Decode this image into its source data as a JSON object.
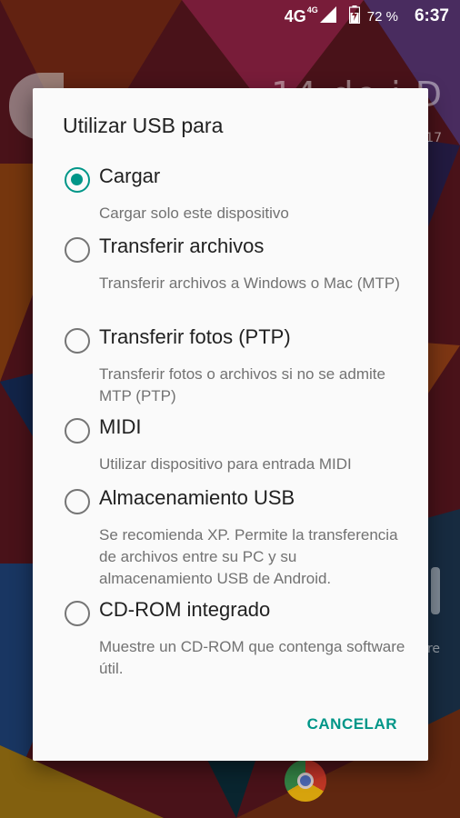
{
  "status_bar": {
    "network": "4G",
    "network_super": "4G",
    "battery_percent": "72 %",
    "time": "6:37",
    "icons": [
      "signal-icon",
      "battery-charging-icon"
    ]
  },
  "dialog": {
    "title": "Utilizar USB para",
    "accent_color": "#009688",
    "options": [
      {
        "label": "Cargar",
        "description": "Cargar solo este dispositivo",
        "selected": true
      },
      {
        "label": "Transferir archivos",
        "description": "Transferir archivos a Windows o Mac (MTP)",
        "selected": false
      },
      {
        "label": "Transferir fotos (PTP)",
        "description": "Transferir fotos o archivos si no se admite MTP (PTP)",
        "selected": false
      },
      {
        "label": "MIDI",
        "description": "Utilizar dispositivo para entrada MIDI",
        "selected": false
      },
      {
        "label": "Almacenamiento USB",
        "description": "Se recomienda XP. Permite la transferencia de archivos entre su PC y su almacenamiento USB de Android.",
        "selected": false
      },
      {
        "label": "CD-ROM integrado",
        "description": "Muestre un CD-ROM que contenga software útil.",
        "selected": false
      }
    ],
    "cancel_label": "CANCELAR"
  }
}
